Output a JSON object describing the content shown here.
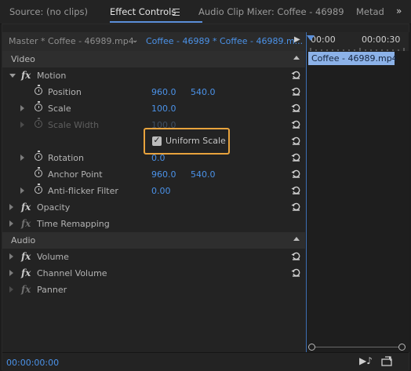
{
  "tabs": [
    {
      "label": "Source: (no clips)"
    },
    {
      "label": "Effect Controls"
    },
    {
      "label": "Audio Clip Mixer: Coffee - 46989"
    },
    {
      "label": "Metad"
    }
  ],
  "header": {
    "master_clip": "Master * Coffee - 46989.mp4",
    "sequence_clip": "Coffee - 46989 * Coffee - 46989.m..."
  },
  "timeline": {
    "tc_start": "00:00",
    "tc_end": "00:00:30",
    "clip_label": "Coffee - 46989.mp4"
  },
  "sections": {
    "video": "Video",
    "audio": "Audio"
  },
  "video": {
    "motion": "Motion",
    "position": {
      "label": "Position",
      "x": "960.0",
      "y": "540.0"
    },
    "scale": {
      "label": "Scale",
      "v": "100.0"
    },
    "scale_width": {
      "label": "Scale Width",
      "v": "100.0"
    },
    "uniform_scale": "Uniform Scale",
    "rotation": {
      "label": "Rotation",
      "v": "0.0"
    },
    "anchor": {
      "label": "Anchor Point",
      "x": "960.0",
      "y": "540.0"
    },
    "antiflicker": {
      "label": "Anti-flicker Filter",
      "v": "0.00"
    },
    "opacity": "Opacity",
    "time_remap": "Time Remapping"
  },
  "audio": {
    "volume": "Volume",
    "channel_volume": "Channel Volume",
    "panner": "Panner"
  },
  "footer": {
    "timecode": "00:00:00:00"
  },
  "colors": {
    "accent": "#4b92e8",
    "highlight": "#e8a33d"
  }
}
